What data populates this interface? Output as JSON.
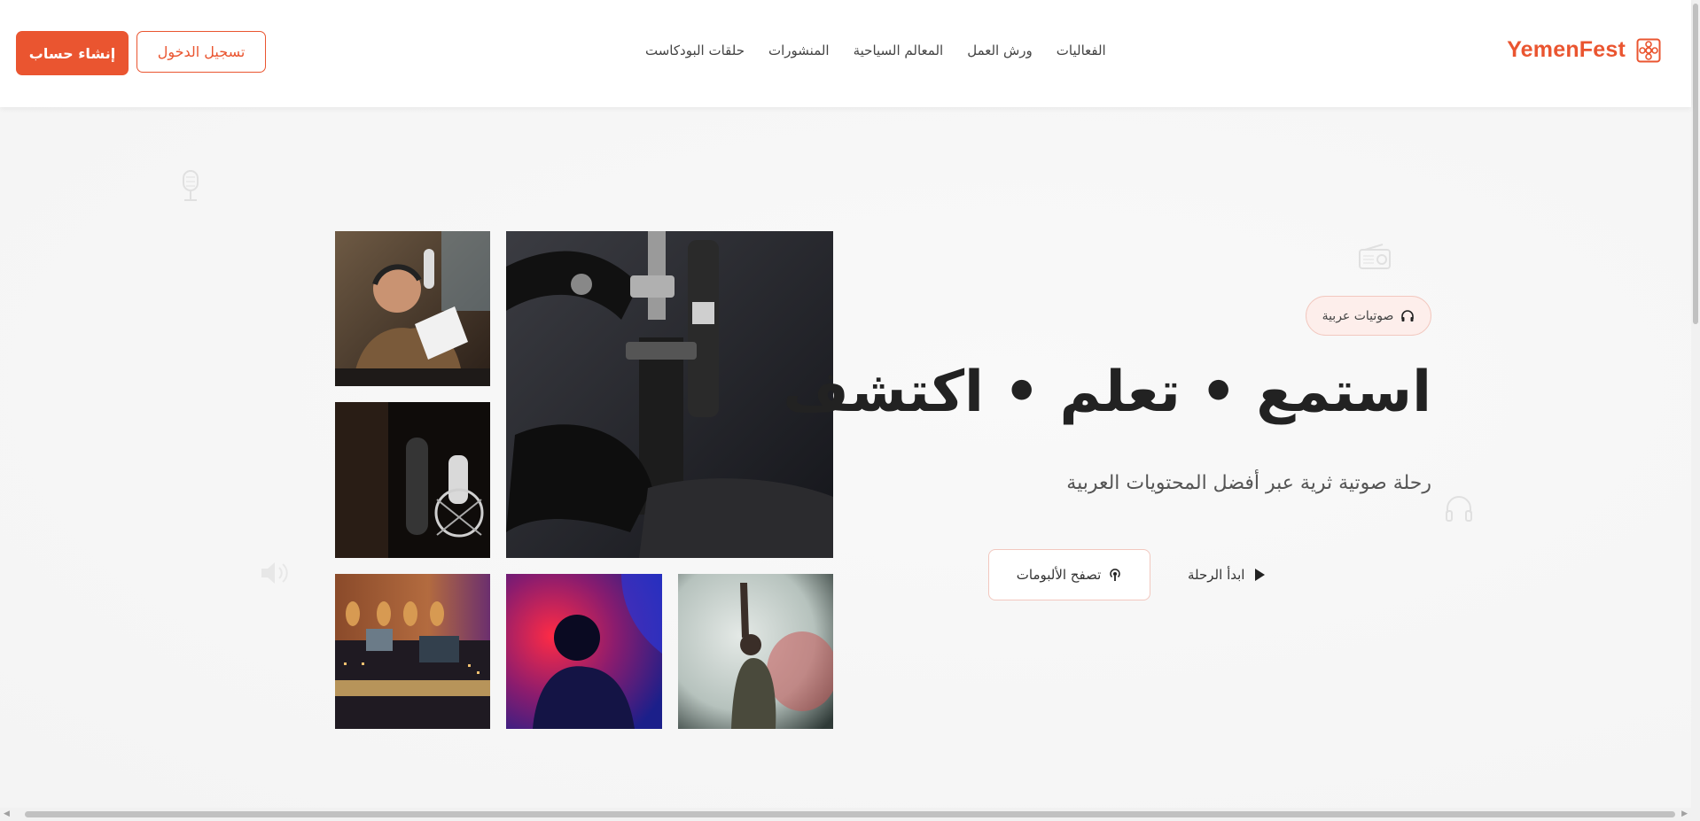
{
  "brand": {
    "name": "YemenFest",
    "accent_color": "#ea5530",
    "logo_icon": "flower-pattern-icon"
  },
  "nav": {
    "items": [
      {
        "label": "الفعاليات"
      },
      {
        "label": "ورش العمل"
      },
      {
        "label": "المعالم السياحية"
      },
      {
        "label": "المنشورات"
      },
      {
        "label": "حلقات البودكاست"
      }
    ]
  },
  "auth": {
    "login_label": "تسجيل الدخول",
    "signup_label": "إنشاء حساب"
  },
  "hero": {
    "badge": {
      "label": "صوتيات عربية",
      "icon": "headphones-icon"
    },
    "title": "استمع • تعلم • اكتشف",
    "subtitle": "رحلة صوتية ثرية عبر أفضل المحتويات العربية",
    "buttons": {
      "browse_label": "تصفح الألبومات",
      "browse_icon": "podcast-icon",
      "start_label": "ابدأ الرحلة",
      "start_icon": "play-icon"
    }
  },
  "gallery": {
    "images": [
      {
        "subject": "man-reading-script-at-microphone"
      },
      {
        "subject": "studio-microphone-on-boom-arm"
      },
      {
        "subject": "condenser-microphone-in-dark"
      },
      {
        "subject": "recording-studio-with-guitars"
      },
      {
        "subject": "silhouette-in-red-blue-light"
      },
      {
        "subject": "person-raising-hand-in-smoke"
      }
    ]
  }
}
